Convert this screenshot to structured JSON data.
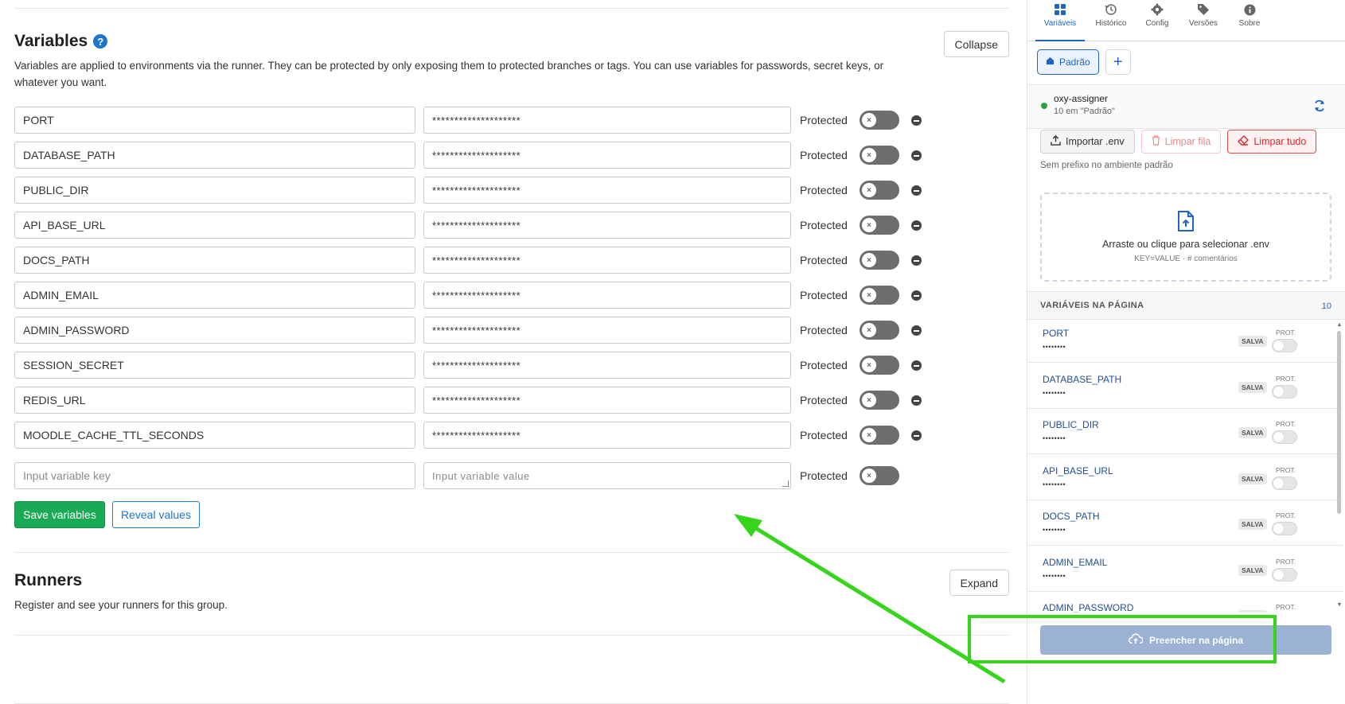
{
  "variables_section": {
    "title": "Variables",
    "description": "Variables are applied to environments via the runner. They can be protected by only exposing them to protected branches or tags. You can use variables for passwords, secret keys, or whatever you want.",
    "collapse_label": "Collapse",
    "protected_label": "Protected",
    "rows": [
      {
        "key": "PORT",
        "value": "********************"
      },
      {
        "key": "DATABASE_PATH",
        "value": "********************"
      },
      {
        "key": "PUBLIC_DIR",
        "value": "********************"
      },
      {
        "key": "API_BASE_URL",
        "value": "********************"
      },
      {
        "key": "DOCS_PATH",
        "value": "********************"
      },
      {
        "key": "ADMIN_EMAIL",
        "value": "********************"
      },
      {
        "key": "ADMIN_PASSWORD",
        "value": "********************"
      },
      {
        "key": "SESSION_SECRET",
        "value": "********************"
      },
      {
        "key": "REDIS_URL",
        "value": "********************"
      },
      {
        "key": "MOODLE_CACHE_TTL_SECONDS",
        "value": "********************"
      }
    ],
    "new_key_placeholder": "Input variable key",
    "new_value_placeholder": "Input variable value",
    "save_label": "Save variables",
    "reveal_label": "Reveal values"
  },
  "runners_section": {
    "title": "Runners",
    "description": "Register and see your runners for this group.",
    "expand_label": "Expand"
  },
  "panel": {
    "tabs": [
      {
        "label": "Variáveis",
        "icon": "grid-icon",
        "active": true
      },
      {
        "label": "Histórico",
        "icon": "history-icon",
        "active": false
      },
      {
        "label": "Config",
        "icon": "gear-icon",
        "active": false
      },
      {
        "label": "Versões",
        "icon": "tag-icon",
        "active": false
      },
      {
        "label": "Sobre",
        "icon": "info-icon",
        "active": false
      }
    ],
    "env_label": "Padrão",
    "add_env_symbol": "+",
    "project_name": "oxy-assigner",
    "project_sub": "10 em \"Padrão\"",
    "import_label": "Importar .env",
    "clear_queue_label": "Limpar fila",
    "clear_all_label": "Limpar tudo",
    "no_prefix_text": "Sem prefixo no ambiente padrão",
    "dropzone_title": "Arraste ou clique para selecionar .env",
    "dropzone_sub": "KEY=VALUE · # comentários",
    "list_title": "VARIÁVEIS NA PÁGINA",
    "list_count": "10",
    "saved_badge": "SALVA",
    "prot_label": "PROT.",
    "mask": "••••••••",
    "items": [
      "PORT",
      "DATABASE_PATH",
      "PUBLIC_DIR",
      "API_BASE_URL",
      "DOCS_PATH",
      "ADMIN_EMAIL",
      "ADMIN_PASSWORD"
    ],
    "fill_label": "Preencher na página"
  },
  "colors": {
    "accent": "#1f65c8",
    "save_green": "#1aaa55",
    "annotation_green": "#37d41c",
    "clear_red": "#d62b2b"
  }
}
